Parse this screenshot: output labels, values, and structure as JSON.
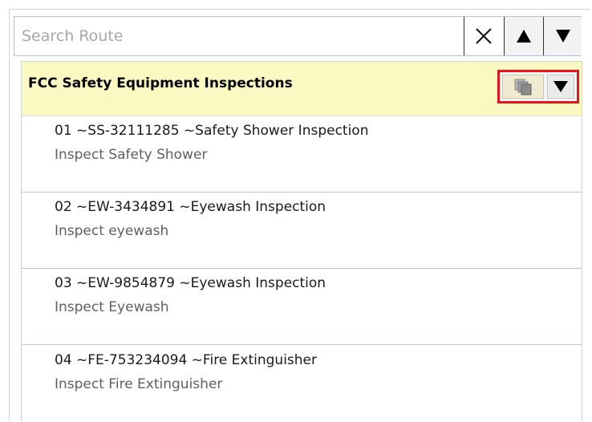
{
  "search": {
    "placeholder": "Search Route",
    "value": ""
  },
  "icons": {
    "clear": "close-icon",
    "up": "triangle-up-icon",
    "down": "triangle-down-icon",
    "copy": "copy-icon",
    "menu": "triangle-down-icon"
  },
  "route": {
    "title": "FCC Safety Equipment Inspections",
    "steps": [
      {
        "title": "01 ~SS-32111285 ~Safety Shower Inspection",
        "description": "Inspect Safety Shower"
      },
      {
        "title": "02 ~EW-3434891 ~Eyewash Inspection",
        "description": "Inspect eyewash"
      },
      {
        "title": "03 ~EW-9854879 ~Eyewash Inspection",
        "description": "Inspect Eyewash"
      },
      {
        "title": "04 ~FE-753234094 ~Fire Extinguisher",
        "description": "Inspect Fire Extinguisher"
      }
    ]
  },
  "colors": {
    "header_background": "#fcf8c2",
    "highlight_border": "#e3151b",
    "divider": "#b9c7d4"
  }
}
